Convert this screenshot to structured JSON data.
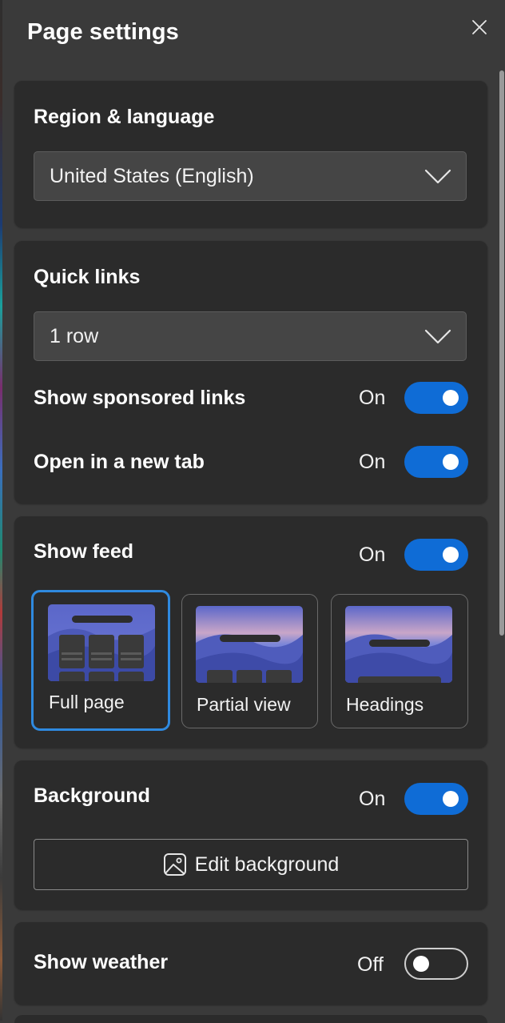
{
  "panel": {
    "title": "Page settings"
  },
  "region": {
    "title": "Region & language",
    "selected": "United States (English)"
  },
  "quick_links": {
    "title": "Quick links",
    "rows_selected": "1 row",
    "sponsored": {
      "label": "Show sponsored links",
      "state": "On"
    },
    "new_tab": {
      "label": "Open in a new tab",
      "state": "On"
    }
  },
  "feed": {
    "title": "Show feed",
    "state": "On",
    "layouts": [
      {
        "label": "Full page",
        "selected": true
      },
      {
        "label": "Partial view",
        "selected": false
      },
      {
        "label": "Headings",
        "selected": false
      }
    ]
  },
  "background": {
    "title": "Background",
    "state": "On",
    "edit_label": "Edit background"
  },
  "weather": {
    "title": "Show weather",
    "state": "Off"
  },
  "colors": {
    "accent": "#0f6cd6",
    "selected_border": "#2f8ae0",
    "card": "#2b2b2b",
    "panel": "#3a3a3a"
  },
  "icons": [
    "close-icon",
    "chevron-down-icon",
    "image-icon"
  ]
}
